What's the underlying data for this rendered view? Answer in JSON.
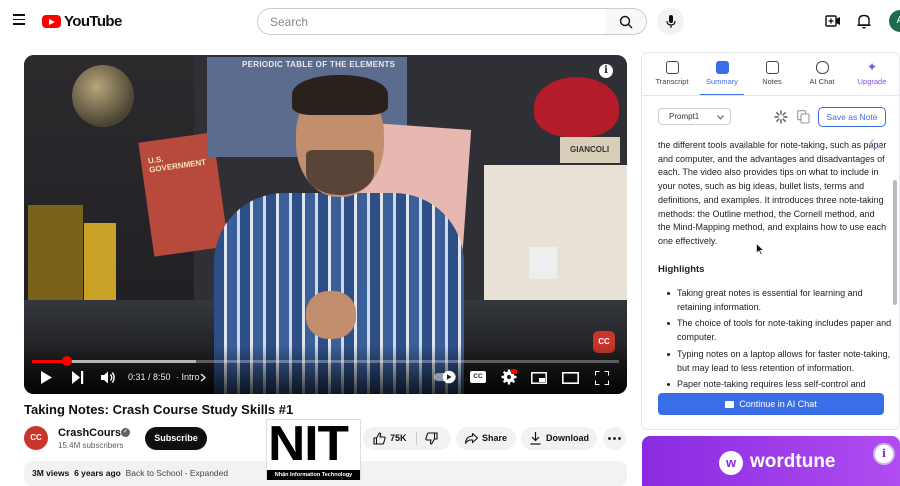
{
  "header": {
    "logo_text": "YouTube",
    "search_placeholder": "Search",
    "avatar_letter": "A"
  },
  "video": {
    "time": "0:31 / 8:50",
    "chapter": "· Intro",
    "progress": 0.059,
    "poster_chart_title": "PERIODIC TABLE OF THE ELEMENTS",
    "poster_text": "U.S. GOVERNMENT",
    "shelf_label": "GIANCOLI",
    "corner_logo": "CC",
    "cc_label": "CC"
  },
  "meta": {
    "title": "Taking Notes: Crash Course Study Skills #1",
    "channel_name": "CrashCourse",
    "channel_initials": "CC",
    "subscribers": "15.4M subscribers",
    "subscribe_label": "Subscribe",
    "likes": "75K",
    "share_label": "Share",
    "download_label": "Download",
    "views": "3M views",
    "age": "6 years ago",
    "description_snippet": "Back to School - Expanded"
  },
  "watermark": {
    "big": "NIT",
    "small": "Nhận Information Technology"
  },
  "panel": {
    "tabs": [
      {
        "label": "Transcript",
        "icon": "transcript-icon"
      },
      {
        "label": "Summary",
        "icon": "summary-icon"
      },
      {
        "label": "Notes",
        "icon": "notes-icon"
      },
      {
        "label": "AI Chat",
        "icon": "chat-icon"
      },
      {
        "label": "Upgrade",
        "icon": "sparkle-icon"
      }
    ],
    "prompt_select": "Prompt1",
    "save_note_label": "Save as Note",
    "summary_text": "the different tools available for note-taking, such as paper and computer, and the advantages and disadvantages of each. The video also provides tips on what to include in your notes, such as big ideas, bullet lists, terms and definitions, and examples. It introduces three note-taking methods: the Outline method, the Cornell method, and the Mind-Mapping method, and explains how to use each one effectively.",
    "highlights_heading": "Highlights",
    "highlights": [
      "Taking great notes is essential for learning and retaining information.",
      "The choice of tools for note-taking includes paper and computer.",
      "Typing notes on a laptop allows for faster note-taking, but may lead to less retention of information.",
      "Paper note-taking requires less self-control and"
    ],
    "continue_label": "Continue in AI Chat"
  },
  "ad": {
    "brand": "wordtune",
    "icon_letter": "w"
  },
  "colors": {
    "brand_red": "#ff0000",
    "accent_blue": "#3a6ee8",
    "wordtune_purple": "#8a2be2"
  }
}
